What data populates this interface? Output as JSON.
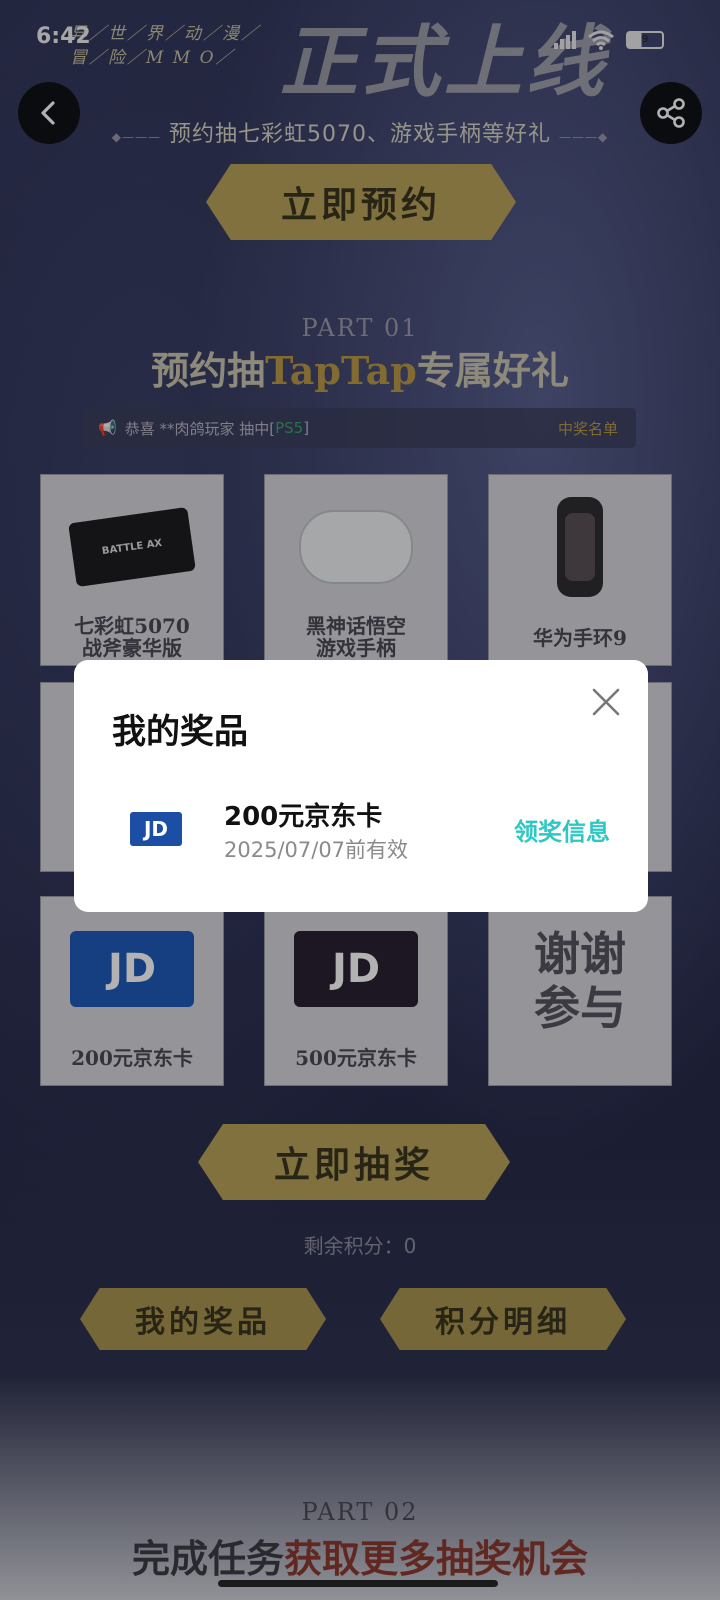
{
  "status_bar": {
    "time": "6:42",
    "battery": "9"
  },
  "hero": {
    "tags": "异／世／界／动／漫／\n冒／险／M M O／",
    "title": "正式上线",
    "subtitle": "预约抽七彩虹5070、游戏手柄等好礼",
    "reserve_button": "立即预约"
  },
  "part1": {
    "label": "PART 01",
    "title_prefix": "预约抽",
    "title_highlight": "TapTap",
    "title_suffix": "专属好礼",
    "ticker_text": "恭喜 **肉鸽玩家 抽中[",
    "ticker_prize": "PS5",
    "ticker_end": "]",
    "ticker_link": "中奖名单"
  },
  "prizes": [
    {
      "name": "七彩虹5070\n战斧豪华版",
      "icon": "graphics-card-image",
      "badge": "BATTLE AX"
    },
    {
      "name": "黑神话悟空\n游戏手柄",
      "icon": "gamepad-image"
    },
    {
      "name": "华为手环9",
      "icon": "smart-band-image"
    },
    {
      "name": "200元京东卡",
      "icon": "jd-card-blue-image",
      "mark": "JD"
    },
    {
      "name": "500元京东卡",
      "icon": "jd-card-dark-image",
      "mark": "JD"
    },
    {
      "name": "谢谢\n参与",
      "icon": "none"
    }
  ],
  "draw_button": "立即抽奖",
  "points_text": "剩余积分：0",
  "bottom_buttons": {
    "my_prizes": "我的奖品",
    "points_detail": "积分明细"
  },
  "part2": {
    "label": "PART 02",
    "title_prefix": "完成任务",
    "title_highlight": "获取更多抽奖机会"
  },
  "modal": {
    "title": "我的奖品",
    "prize_icon": "JD",
    "prize_name": "200元京东卡",
    "prize_expiry": "2025/07/07前有效",
    "claim_link": "领奖信息"
  },
  "colors": {
    "accent": "#2ec8c4",
    "gold": "#b8a25a",
    "jd_blue": "#1d4ea6"
  }
}
